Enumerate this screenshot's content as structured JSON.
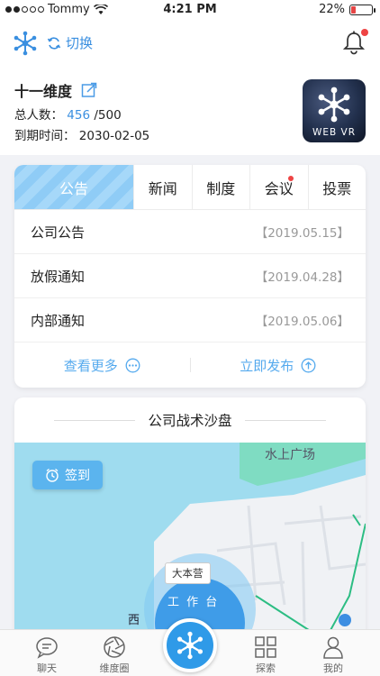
{
  "status_bar": {
    "carrier": "Tommy",
    "time": "4:21 PM",
    "battery": "22%"
  },
  "header": {
    "switch_label": "切换"
  },
  "company": {
    "name": "十一维度",
    "members_label": "总人数：",
    "members_current": "456",
    "members_total": "/500",
    "expiry_label": "到期时间：",
    "expiry_date": "2030-02-05",
    "app_logo_text": "WEB VR"
  },
  "notice_card": {
    "tabs": [
      {
        "label": "公告",
        "active": true,
        "badge": false
      },
      {
        "label": "新闻",
        "active": false,
        "badge": false
      },
      {
        "label": "制度",
        "active": false,
        "badge": false
      },
      {
        "label": "会议",
        "active": false,
        "badge": true
      },
      {
        "label": "投票",
        "active": false,
        "badge": false
      }
    ],
    "items": [
      {
        "title": "公司公告",
        "date": "【2019.05.15】"
      },
      {
        "title": "放假通知",
        "date": "【2019.04.28】"
      },
      {
        "title": "内部通知",
        "date": "【2019.05.06】"
      }
    ],
    "view_more_label": "查看更多",
    "publish_label": "立即发布"
  },
  "sandbox": {
    "title": "公司战术沙盘",
    "sign_in_label": "签到",
    "place_label": "水上广场",
    "hq_label": "大本营",
    "workbench_label": "工 作 台",
    "partial_label": "西"
  },
  "tabbar": {
    "items": [
      {
        "label": "聊天",
        "icon": "chat-icon"
      },
      {
        "label": "维度圈",
        "icon": "aperture-icon"
      },
      {
        "label": "探索",
        "icon": "grid-icon"
      },
      {
        "label": "我的",
        "icon": "user-icon"
      }
    ]
  },
  "colors": {
    "accent": "#3a8fe0",
    "tab_active": "#9dd4f8",
    "map_water": "#9fdcef",
    "badge": "#ee4444"
  }
}
